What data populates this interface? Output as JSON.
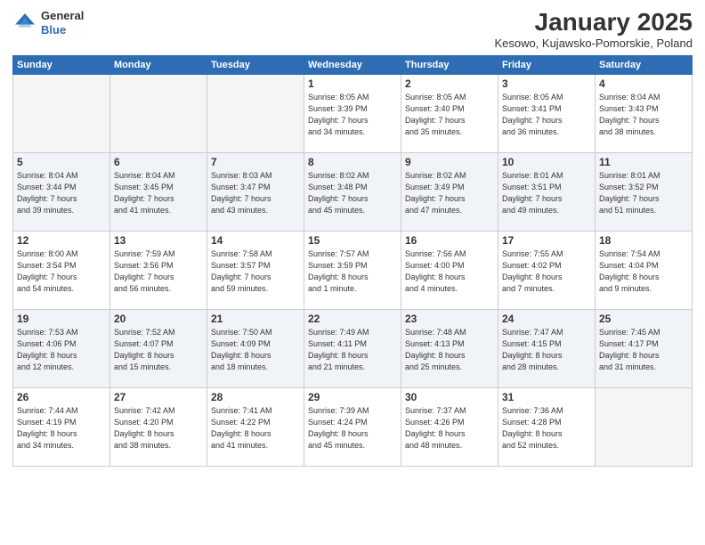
{
  "logo": {
    "general": "General",
    "blue": "Blue"
  },
  "title": "January 2025",
  "location": "Kesowo, Kujawsko-Pomorskie, Poland",
  "weekdays": [
    "Sunday",
    "Monday",
    "Tuesday",
    "Wednesday",
    "Thursday",
    "Friday",
    "Saturday"
  ],
  "weeks": [
    [
      {
        "day": "",
        "info": ""
      },
      {
        "day": "",
        "info": ""
      },
      {
        "day": "",
        "info": ""
      },
      {
        "day": "1",
        "info": "Sunrise: 8:05 AM\nSunset: 3:39 PM\nDaylight: 7 hours\nand 34 minutes."
      },
      {
        "day": "2",
        "info": "Sunrise: 8:05 AM\nSunset: 3:40 PM\nDaylight: 7 hours\nand 35 minutes."
      },
      {
        "day": "3",
        "info": "Sunrise: 8:05 AM\nSunset: 3:41 PM\nDaylight: 7 hours\nand 36 minutes."
      },
      {
        "day": "4",
        "info": "Sunrise: 8:04 AM\nSunset: 3:43 PM\nDaylight: 7 hours\nand 38 minutes."
      }
    ],
    [
      {
        "day": "5",
        "info": "Sunrise: 8:04 AM\nSunset: 3:44 PM\nDaylight: 7 hours\nand 39 minutes."
      },
      {
        "day": "6",
        "info": "Sunrise: 8:04 AM\nSunset: 3:45 PM\nDaylight: 7 hours\nand 41 minutes."
      },
      {
        "day": "7",
        "info": "Sunrise: 8:03 AM\nSunset: 3:47 PM\nDaylight: 7 hours\nand 43 minutes."
      },
      {
        "day": "8",
        "info": "Sunrise: 8:02 AM\nSunset: 3:48 PM\nDaylight: 7 hours\nand 45 minutes."
      },
      {
        "day": "9",
        "info": "Sunrise: 8:02 AM\nSunset: 3:49 PM\nDaylight: 7 hours\nand 47 minutes."
      },
      {
        "day": "10",
        "info": "Sunrise: 8:01 AM\nSunset: 3:51 PM\nDaylight: 7 hours\nand 49 minutes."
      },
      {
        "day": "11",
        "info": "Sunrise: 8:01 AM\nSunset: 3:52 PM\nDaylight: 7 hours\nand 51 minutes."
      }
    ],
    [
      {
        "day": "12",
        "info": "Sunrise: 8:00 AM\nSunset: 3:54 PM\nDaylight: 7 hours\nand 54 minutes."
      },
      {
        "day": "13",
        "info": "Sunrise: 7:59 AM\nSunset: 3:56 PM\nDaylight: 7 hours\nand 56 minutes."
      },
      {
        "day": "14",
        "info": "Sunrise: 7:58 AM\nSunset: 3:57 PM\nDaylight: 7 hours\nand 59 minutes."
      },
      {
        "day": "15",
        "info": "Sunrise: 7:57 AM\nSunset: 3:59 PM\nDaylight: 8 hours\nand 1 minute."
      },
      {
        "day": "16",
        "info": "Sunrise: 7:56 AM\nSunset: 4:00 PM\nDaylight: 8 hours\nand 4 minutes."
      },
      {
        "day": "17",
        "info": "Sunrise: 7:55 AM\nSunset: 4:02 PM\nDaylight: 8 hours\nand 7 minutes."
      },
      {
        "day": "18",
        "info": "Sunrise: 7:54 AM\nSunset: 4:04 PM\nDaylight: 8 hours\nand 9 minutes."
      }
    ],
    [
      {
        "day": "19",
        "info": "Sunrise: 7:53 AM\nSunset: 4:06 PM\nDaylight: 8 hours\nand 12 minutes."
      },
      {
        "day": "20",
        "info": "Sunrise: 7:52 AM\nSunset: 4:07 PM\nDaylight: 8 hours\nand 15 minutes."
      },
      {
        "day": "21",
        "info": "Sunrise: 7:50 AM\nSunset: 4:09 PM\nDaylight: 8 hours\nand 18 minutes."
      },
      {
        "day": "22",
        "info": "Sunrise: 7:49 AM\nSunset: 4:11 PM\nDaylight: 8 hours\nand 21 minutes."
      },
      {
        "day": "23",
        "info": "Sunrise: 7:48 AM\nSunset: 4:13 PM\nDaylight: 8 hours\nand 25 minutes."
      },
      {
        "day": "24",
        "info": "Sunrise: 7:47 AM\nSunset: 4:15 PM\nDaylight: 8 hours\nand 28 minutes."
      },
      {
        "day": "25",
        "info": "Sunrise: 7:45 AM\nSunset: 4:17 PM\nDaylight: 8 hours\nand 31 minutes."
      }
    ],
    [
      {
        "day": "26",
        "info": "Sunrise: 7:44 AM\nSunset: 4:19 PM\nDaylight: 8 hours\nand 34 minutes."
      },
      {
        "day": "27",
        "info": "Sunrise: 7:42 AM\nSunset: 4:20 PM\nDaylight: 8 hours\nand 38 minutes."
      },
      {
        "day": "28",
        "info": "Sunrise: 7:41 AM\nSunset: 4:22 PM\nDaylight: 8 hours\nand 41 minutes."
      },
      {
        "day": "29",
        "info": "Sunrise: 7:39 AM\nSunset: 4:24 PM\nDaylight: 8 hours\nand 45 minutes."
      },
      {
        "day": "30",
        "info": "Sunrise: 7:37 AM\nSunset: 4:26 PM\nDaylight: 8 hours\nand 48 minutes."
      },
      {
        "day": "31",
        "info": "Sunrise: 7:36 AM\nSunset: 4:28 PM\nDaylight: 8 hours\nand 52 minutes."
      },
      {
        "day": "",
        "info": ""
      }
    ]
  ]
}
